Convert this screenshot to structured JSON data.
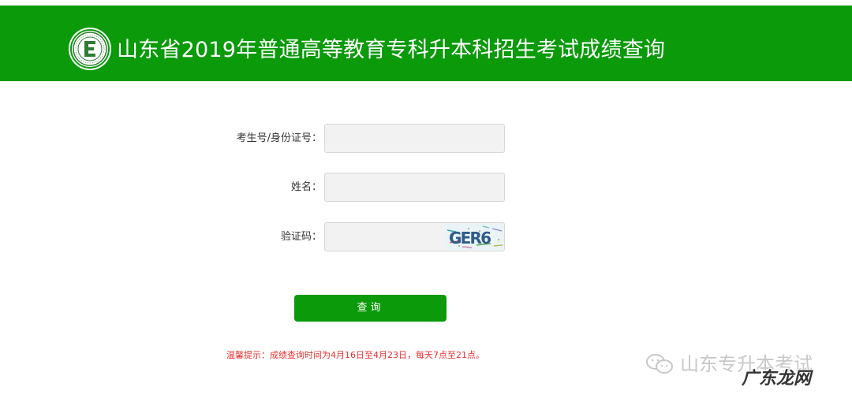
{
  "header": {
    "title": "山东省2019年普通高等教育专科升本科招生考试成绩查询",
    "background_color": "#0a9a0a",
    "logo_icon": "e-emblem-icon"
  },
  "form": {
    "exam_id": {
      "label": "考生号/身份证号：",
      "value": "",
      "placeholder": ""
    },
    "name": {
      "label": "姓名：",
      "value": "",
      "placeholder": ""
    },
    "captcha": {
      "label": "验证码：",
      "value": "",
      "placeholder": "",
      "image_text": "GER6"
    },
    "submit_label": "查询"
  },
  "notice": {
    "text": "温馨提示：成绩查询时间为4月16日至4月23日，每天7点至21点。",
    "color": "#e53030"
  },
  "watermark": {
    "source": "山东专升本考试",
    "site": "广东龙网"
  }
}
